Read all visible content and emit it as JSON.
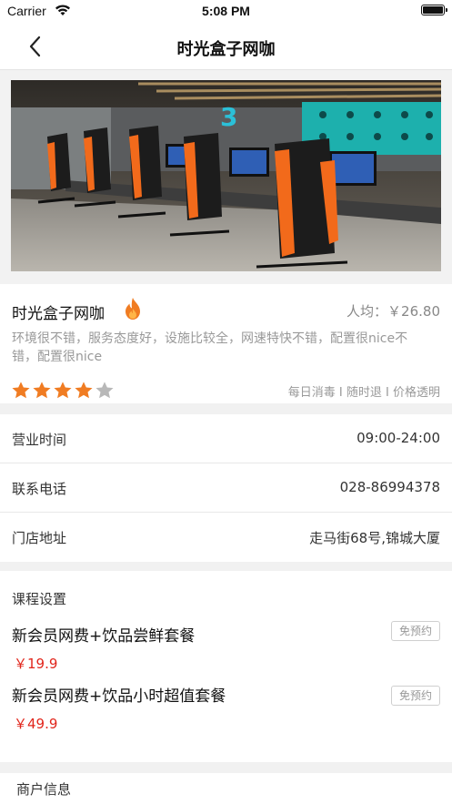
{
  "status_bar": {
    "carrier": "Carrier",
    "time": "5:08 PM"
  },
  "nav": {
    "title": "时光盒子网咖"
  },
  "shop": {
    "name": "时光盒子网咖",
    "avg_price": "人均：￥26.80",
    "description": "环境很不错，服务态度好，设施比较全，网速特快不错，配置很nice不错，配置很nice",
    "rating": 4,
    "rating_max": 5,
    "tags": "每日消毒 I 随时退 I 价格透明"
  },
  "details": {
    "hours_label": "营业时间",
    "hours_value": "09:00-24:00",
    "phone_label": "联系电话",
    "phone_value": "028-86994378",
    "address_label": "门店地址",
    "address_value": "走马街68号,锦城大厦"
  },
  "course": {
    "title": "课程设置",
    "packages": [
      {
        "name": "新会员网费+饮品尝鲜套餐",
        "badge": "免预约",
        "price": "￥19.9"
      },
      {
        "name": "新会员网费+饮品小时超值套餐",
        "badge": "免预约",
        "price": "￥49.9"
      }
    ]
  },
  "merchant": {
    "title": "商户信息"
  },
  "colors": {
    "accent_orange": "#f07c22",
    "price_red": "#e1251b",
    "star_empty": "#b8b8b8"
  },
  "icons": {
    "back": "chevron-left-icon",
    "fire": "fire-icon",
    "star": "star-icon"
  }
}
